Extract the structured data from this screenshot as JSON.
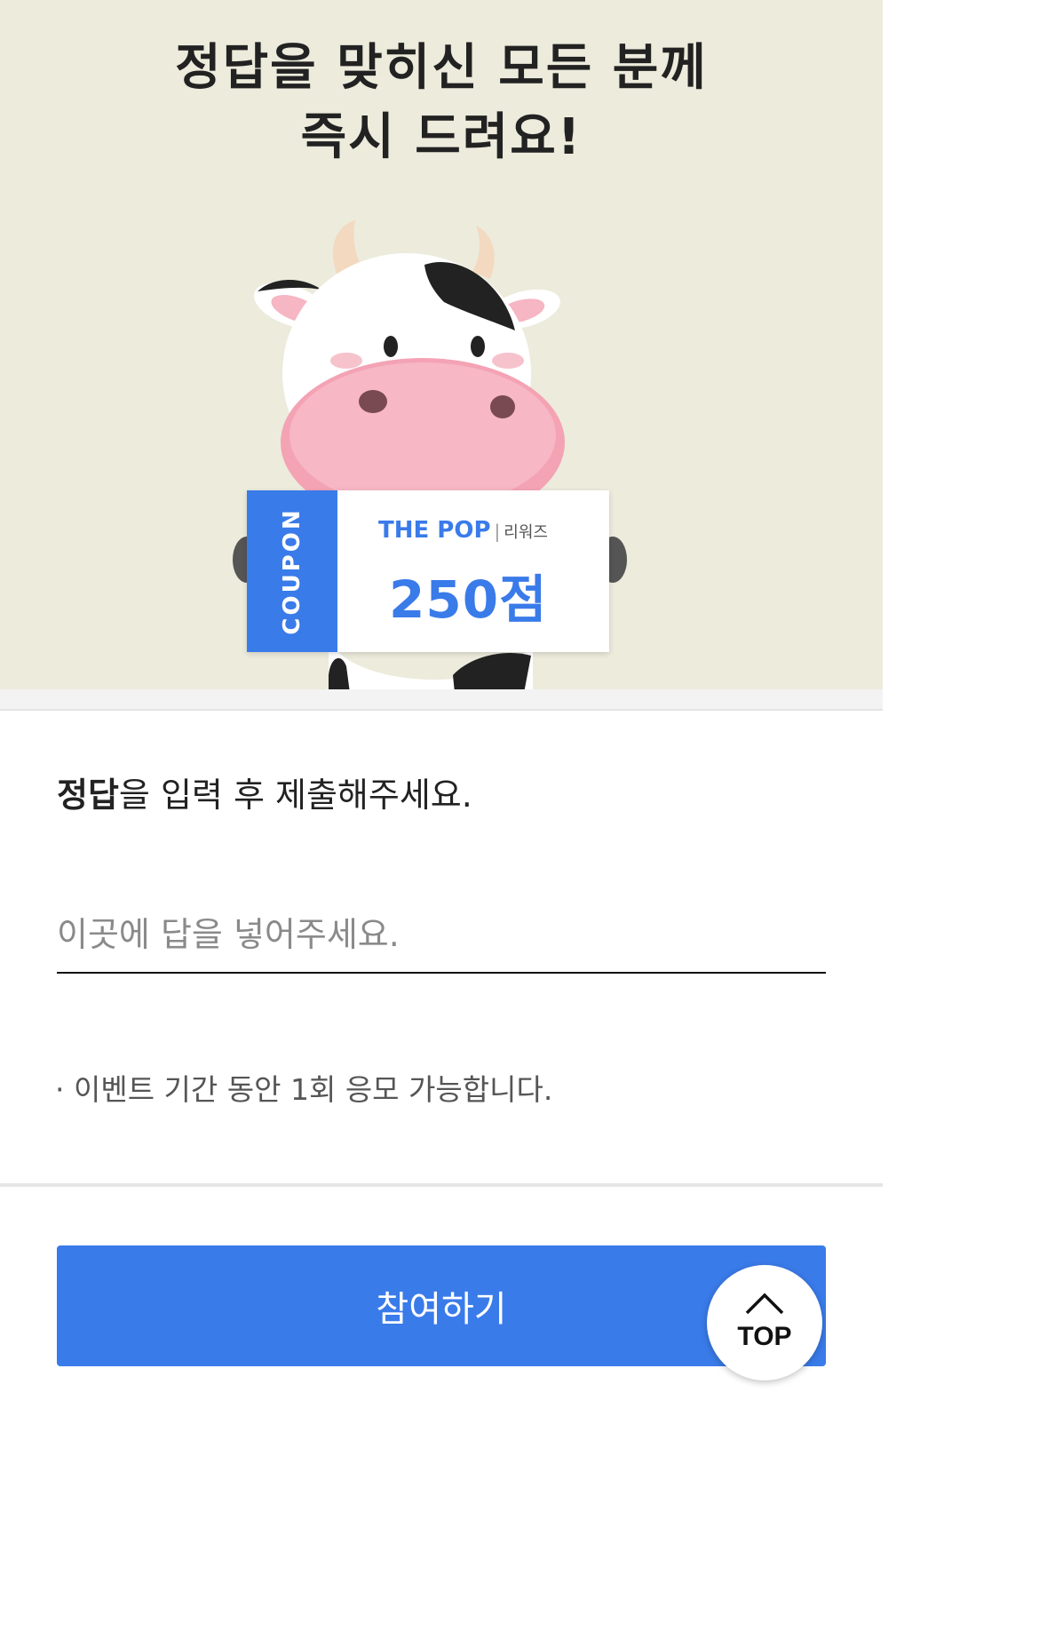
{
  "banner": {
    "headline_line1": "정답을 맞히신 모든 분께",
    "headline_line2": "즉시 드려요!",
    "background_color": "#ecebdc",
    "coupon": {
      "side_label": "COUPON",
      "brand_name": "THE POP",
      "brand_sub": "리워즈",
      "points": "250점",
      "accent_color": "#3a7bea"
    },
    "character": "cow-mascot"
  },
  "form": {
    "instruction_bold": "정답",
    "instruction_rest": "을 입력 후 제출해주세요.",
    "answer_placeholder": "이곳에 답을 넣어주세요.",
    "note": "· 이벤트 기간 동안 1회 응모 가능합니다."
  },
  "actions": {
    "submit_label": "참여하기",
    "top_label": "TOP",
    "primary_color": "#3a7bea"
  }
}
